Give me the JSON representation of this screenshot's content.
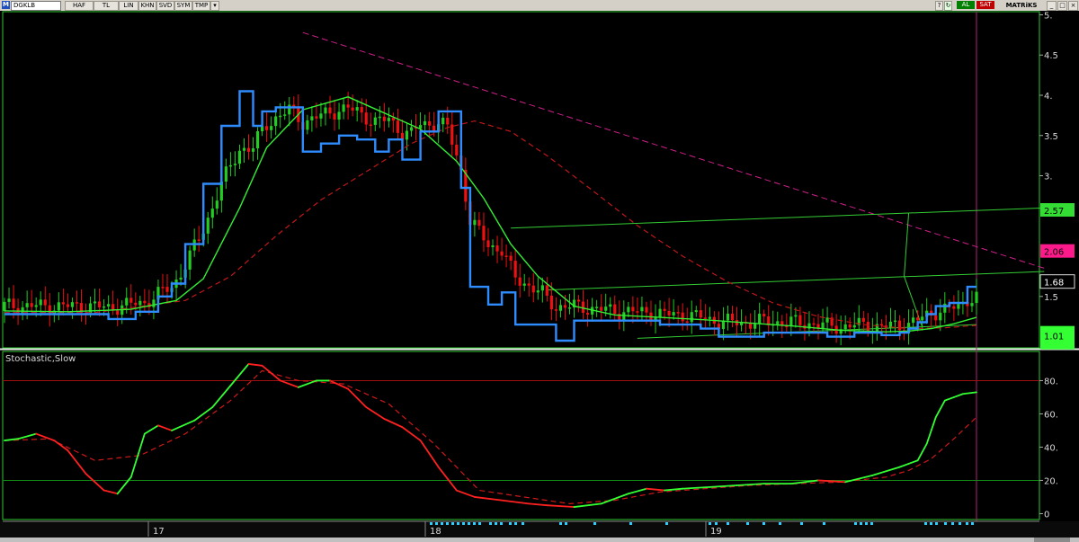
{
  "toolbar": {
    "logo": "M",
    "symbol": "DGKLB",
    "buttons": [
      "HAF",
      "TL",
      "LIN",
      "KHN",
      "SVD",
      "SYM",
      "TMP"
    ],
    "buy_label": "AL",
    "sell_label": "SAT",
    "brand": "MATRiKS"
  },
  "price_panel": {
    "y_ticks": [
      "5.",
      "4.5",
      "4.",
      "3.5",
      "3.",
      "1.5"
    ],
    "tags": [
      {
        "label": "2.57",
        "color": "#33dd33",
        "text_color": "#000000"
      },
      {
        "label": "2.06",
        "color": "#ff1a8c",
        "text_color": "#000000"
      },
      {
        "label": "1.68",
        "color": "#000000",
        "text_color": "#ffffff"
      },
      {
        "label": "1.01",
        "color": "#33ff33",
        "text_color": "#000000"
      }
    ]
  },
  "stoch_panel": {
    "title": "Stochastic,Slow",
    "y_ticks": [
      "80.",
      "60.",
      "40.",
      "20.",
      "0"
    ]
  },
  "x_labels": [
    "17",
    "18",
    "19"
  ],
  "colors": {
    "up_candle": "#22cc22",
    "down_candle": "#ee1111",
    "stop_line": "#2f8cff",
    "sma_fast": "#33ee33",
    "sma_slow": "#c01818",
    "trend_down": "#d0208a",
    "channel": "#33cc33"
  },
  "chart_data": [
    {
      "type": "candlestick",
      "y_ticks": [
        1.5,
        3,
        3.5,
        4,
        4.5,
        5
      ],
      "ylim": [
        0.85,
        5.05
      ],
      "x_ticks": [
        "17",
        "18",
        "19"
      ],
      "price_tags": [
        2.57,
        2.06,
        1.68,
        1.01
      ],
      "series": [
        {
          "name": "",
          "type": "line",
          "note": "stepped stop line",
          "x": [
            0,
            14,
            18,
            23,
            29,
            31,
            34,
            37,
            40,
            44,
            48,
            52,
            55,
            57,
            60,
            63,
            66,
            70,
            74,
            78,
            82,
            85,
            88,
            90,
            92,
            96,
            98,
            101,
            103,
            107,
            110,
            113,
            117,
            119,
            122,
            126,
            128,
            132,
            135,
            140,
            145,
            150,
            154,
            158,
            161,
            164,
            168,
            171,
            175,
            179,
            182,
            185,
            188,
            191,
            194,
            198,
            200,
            202,
            204,
            206,
            209,
            211,
            213,
            215
          ],
          "values": [
            1.28,
            1.28,
            1.28,
            1.22,
            1.31,
            1.31,
            1.5,
            1.66,
            2.15,
            2.9,
            3.62,
            4.05,
            3.62,
            3.8,
            3.85,
            3.85,
            3.3,
            3.4,
            3.5,
            3.45,
            3.3,
            3.45,
            3.2,
            3.2,
            3.55,
            3.8,
            3.8,
            2.85,
            1.62,
            1.4,
            1.55,
            1.15,
            1.15,
            1.15,
            0.95,
            1.2,
            1.2,
            1.2,
            1.2,
            1.2,
            1.15,
            1.15,
            1.1,
            1.0,
            1.0,
            1.0,
            1.05,
            1.05,
            1.05,
            1.05,
            1.0,
            1.0,
            1.05,
            1.05,
            1.02,
            1.05,
            1.1,
            1.18,
            1.28,
            1.38,
            1.42,
            1.42,
            1.62,
            1.62
          ]
        },
        {
          "name": "",
          "type": "line",
          "note": "fast moving average",
          "x": [
            0,
            14,
            28,
            38,
            44,
            52,
            58,
            66,
            76,
            84,
            92,
            100,
            106,
            112,
            118,
            126,
            135,
            145,
            155,
            165,
            175,
            185,
            195,
            200,
            205,
            210,
            215
          ],
          "values": [
            1.32,
            1.31,
            1.34,
            1.45,
            1.72,
            2.6,
            3.35,
            3.82,
            3.98,
            3.78,
            3.58,
            3.18,
            2.72,
            2.15,
            1.75,
            1.38,
            1.27,
            1.24,
            1.21,
            1.17,
            1.13,
            1.08,
            1.06,
            1.07,
            1.1,
            1.16,
            1.24
          ]
        },
        {
          "name": "",
          "type": "line",
          "note": "slow moving average (dashed)",
          "x": [
            0,
            20,
            40,
            50,
            60,
            70,
            80,
            90,
            98,
            104,
            112,
            120,
            130,
            140,
            150,
            160,
            170,
            180,
            190,
            200,
            208,
            215
          ],
          "values": [
            1.3,
            1.3,
            1.45,
            1.75,
            2.25,
            2.7,
            3.05,
            3.4,
            3.6,
            3.68,
            3.55,
            3.25,
            2.82,
            2.38,
            2.0,
            1.68,
            1.42,
            1.25,
            1.15,
            1.1,
            1.11,
            1.14
          ]
        }
      ],
      "trendlines": [
        {
          "note": "falling resistance (dashed)",
          "x": [
            66,
            230
          ],
          "values": [
            4.78,
            1.85
          ]
        },
        {
          "note": "upper channel",
          "x": [
            112,
            230
          ],
          "values": [
            2.35,
            2.6
          ]
        },
        {
          "note": "middle channel",
          "x": [
            120,
            230
          ],
          "values": [
            1.58,
            1.81
          ]
        },
        {
          "note": "lower channel",
          "x": [
            140,
            215
          ],
          "values": [
            0.98,
            1.15
          ]
        }
      ],
      "candles_note": "candlestick bodies drawn from the series shape (up = green, down = red)"
    },
    {
      "type": "line",
      "title": "Stochastic,Slow",
      "y_ticks": [
        0,
        20,
        40,
        60,
        80
      ],
      "ylim": [
        -3,
        97
      ],
      "reference_lines": [
        20,
        80
      ],
      "series": [
        {
          "name": "",
          "note": "%K, green when rising, red when falling",
          "x": [
            0,
            3,
            7,
            11,
            14,
            18,
            22,
            25,
            28,
            31,
            34,
            37,
            42,
            46,
            50,
            54,
            57,
            61,
            65,
            69,
            72,
            76,
            80,
            84,
            88,
            92,
            96,
            100,
            104,
            110,
            116,
            120,
            126,
            132,
            138,
            142,
            146,
            150,
            156,
            162,
            168,
            174,
            180,
            186,
            192,
            198,
            200,
            202,
            204,
            206,
            208,
            210,
            212,
            215
          ],
          "values": [
            44,
            45,
            48,
            44,
            38,
            24,
            14,
            12,
            22,
            48,
            53,
            50,
            56,
            64,
            77,
            90,
            89,
            80,
            76,
            80,
            80,
            75,
            64,
            57,
            52,
            44,
            28,
            14,
            10,
            8,
            6,
            5,
            4,
            6,
            12,
            15,
            14,
            15,
            16,
            17,
            18,
            18,
            20,
            19,
            23,
            28,
            30,
            32,
            42,
            58,
            68,
            70,
            72,
            73
          ]
        },
        {
          "name": "",
          "note": "%D (dashed)",
          "x": [
            0,
            10,
            20,
            30,
            40,
            50,
            57,
            65,
            75,
            85,
            95,
            105,
            115,
            125,
            135,
            145,
            155,
            165,
            175,
            185,
            195,
            200,
            205,
            210,
            215
          ],
          "values": [
            44,
            45,
            32,
            35,
            48,
            68,
            86,
            80,
            78,
            66,
            42,
            14,
            10,
            6,
            8,
            13,
            15,
            17,
            18,
            19,
            22,
            26,
            33,
            45,
            58
          ]
        }
      ]
    }
  ]
}
